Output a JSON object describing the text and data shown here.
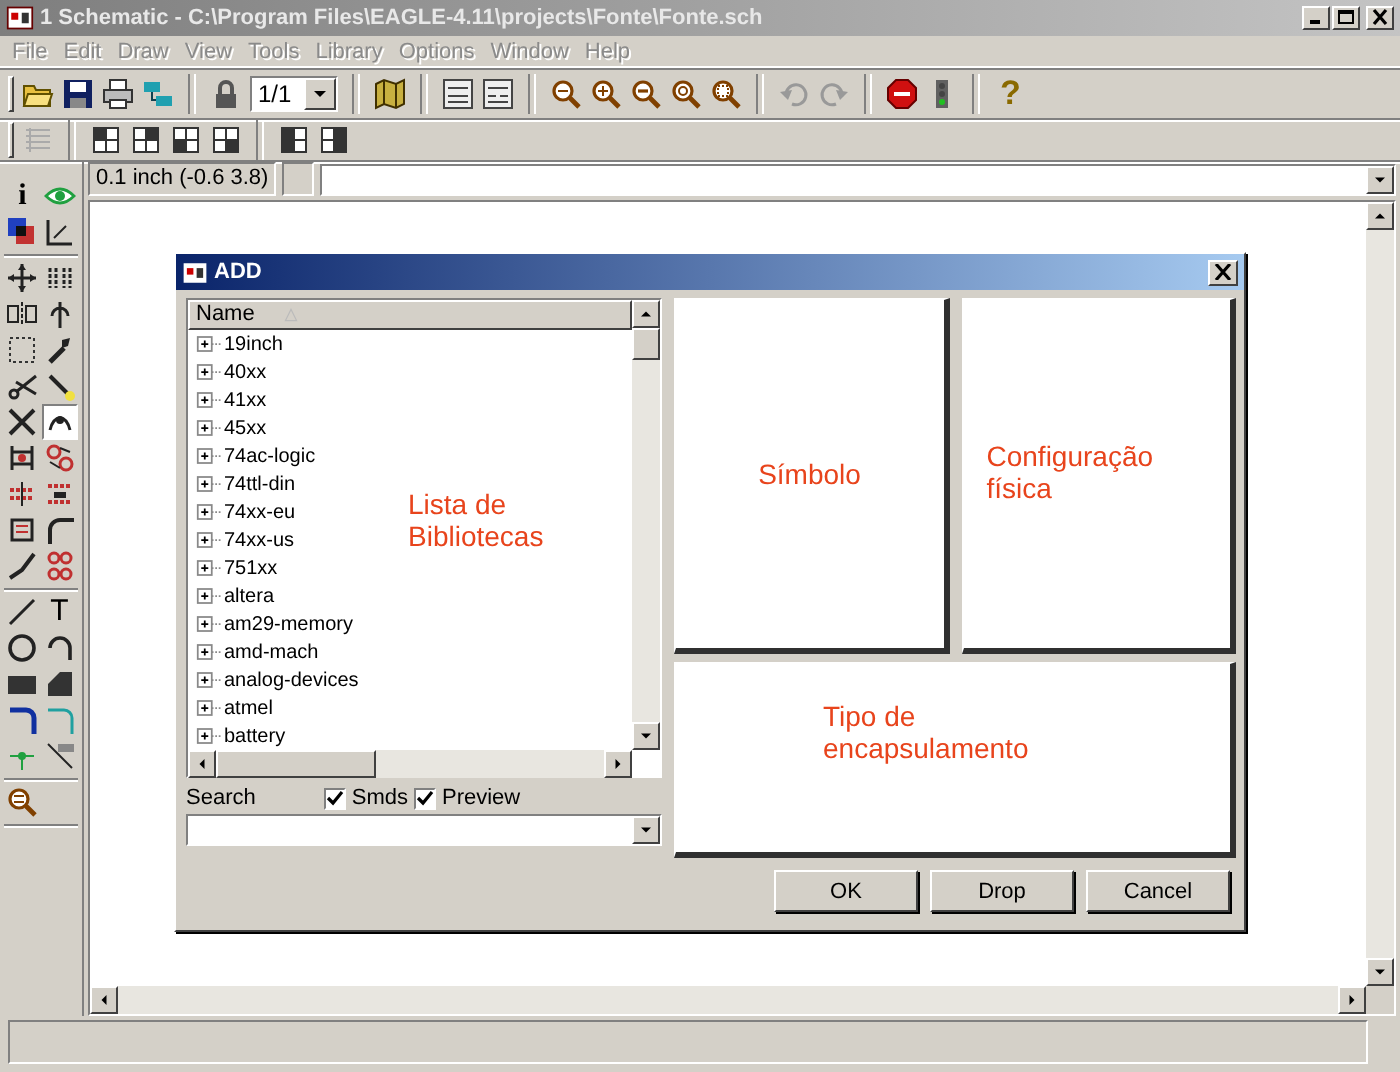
{
  "window": {
    "title": "1 Schematic - C:\\Program Files\\EAGLE-4.11\\projects\\Fonte\\Fonte.sch"
  },
  "menu": [
    {
      "label": "File",
      "disabled": true
    },
    {
      "label": "Edit",
      "disabled": true
    },
    {
      "label": "Draw",
      "disabled": true
    },
    {
      "label": "View",
      "disabled": true
    },
    {
      "label": "Tools",
      "disabled": true
    },
    {
      "label": "Library",
      "disabled": true
    },
    {
      "label": "Options",
      "disabled": true
    },
    {
      "label": "Window",
      "disabled": true
    },
    {
      "label": "Help",
      "disabled": true
    }
  ],
  "toolbar": {
    "page_select": "1/1",
    "help": "?"
  },
  "coordinates": {
    "readout": "0.1 inch (-0.6 3.8)"
  },
  "toolbox": {
    "info": "i",
    "text": "T"
  },
  "dialog": {
    "title": "ADD",
    "list": {
      "header": "Name",
      "items": [
        "19inch",
        "40xx",
        "41xx",
        "45xx",
        "74ac-logic",
        "74ttl-din",
        "74xx-eu",
        "74xx-us",
        "751xx",
        "altera",
        "am29-memory",
        "amd-mach",
        "analog-devices",
        "atmel",
        "battery"
      ]
    },
    "search": {
      "label": "Search"
    },
    "options": [
      {
        "label": "Smds",
        "checked": true
      },
      {
        "label": "Preview",
        "checked": true
      }
    ],
    "annotations": {
      "library_list": "Lista de Bibliotecas",
      "symbol": "Símbolo",
      "configuration": "Configuração física",
      "package": "Tipo de encapsulamento"
    },
    "buttons": [
      "OK",
      "Drop",
      "Cancel"
    ]
  }
}
